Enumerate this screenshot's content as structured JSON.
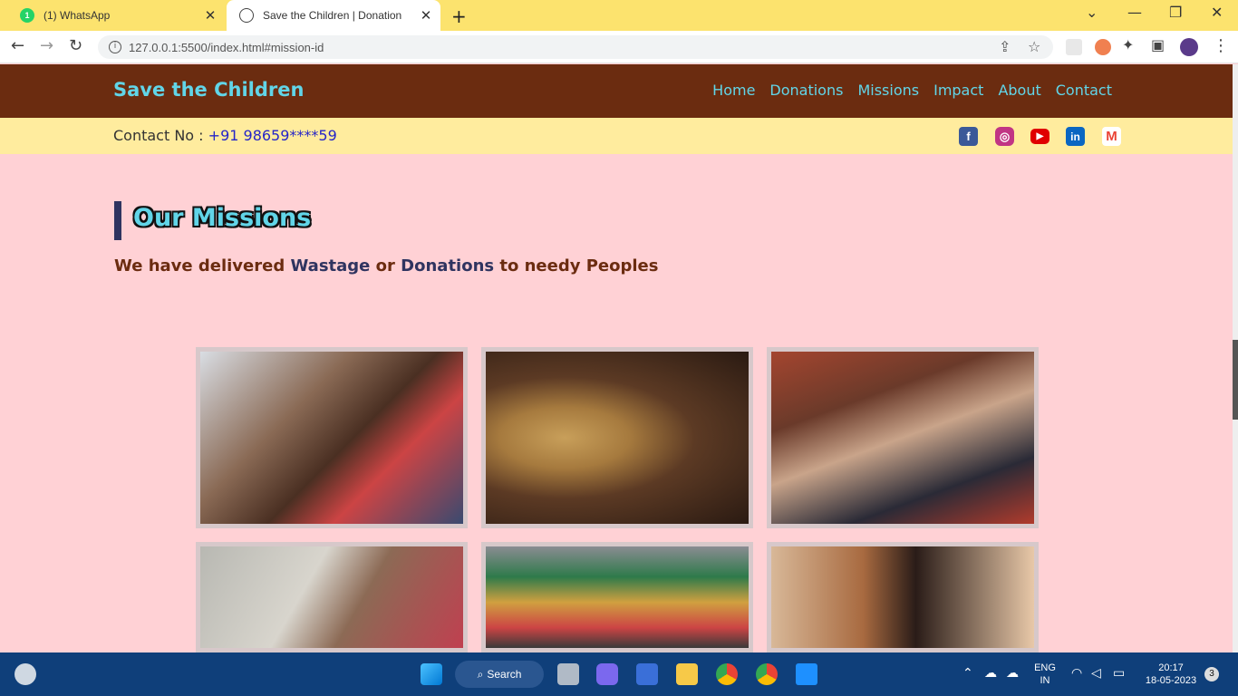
{
  "browser": {
    "tabs": [
      {
        "label": "(1) WhatsApp",
        "badge": "1"
      },
      {
        "label": "Save the Children | Donation"
      }
    ],
    "url": "127.0.0.1:5500/index.html#mission-id",
    "icons": [
      "back-icon",
      "forward-icon",
      "reload-icon",
      "info-icon",
      "share-icon",
      "star-icon",
      "extensions-icon",
      "sidepanel-icon",
      "profile-avatar",
      "menu-icon"
    ]
  },
  "site": {
    "brand": "Save the Children",
    "nav": [
      "Home",
      "Donations",
      "Missions",
      "Impact",
      "About",
      "Contact"
    ],
    "contact_label": "Contact No : ",
    "contact_number": "+91 98659****59",
    "social": [
      {
        "name": "facebook-icon",
        "glyph": "f",
        "color": "#3b5998"
      },
      {
        "name": "instagram-icon",
        "glyph": "◎",
        "color": "#c13584"
      },
      {
        "name": "youtube-icon",
        "glyph": "▶",
        "color": "#e00000"
      },
      {
        "name": "linkedin-icon",
        "glyph": "in",
        "color": "#0a66c2"
      },
      {
        "name": "gmail-icon",
        "glyph": "M",
        "color": "#ea4335"
      }
    ]
  },
  "missions": {
    "title": "Our Missions",
    "subtitle_pre": "We have delivered ",
    "subtitle_hl1": "Wastage",
    "subtitle_mid": " or ",
    "subtitle_hl2": "Donations",
    "subtitle_post": " to needy Peoples",
    "gallery": [
      "mission-photo-1",
      "mission-photo-2",
      "mission-photo-3",
      "mission-photo-4",
      "mission-photo-5",
      "mission-photo-6"
    ]
  },
  "taskbar": {
    "search_label": "Search",
    "lang_top": "ENG",
    "lang_bottom": "IN",
    "time": "20:17",
    "date": "18-05-2023",
    "notifications": "3"
  }
}
